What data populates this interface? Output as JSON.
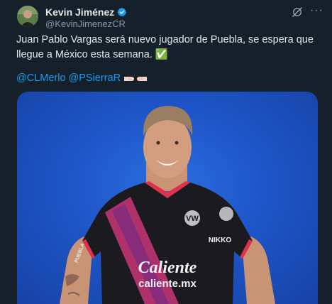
{
  "author": {
    "display_name": "Kevin Jiménez",
    "handle": "@KevinJimenezCR"
  },
  "icons": {
    "avatar": "avatar-photo",
    "verified": "verified-badge-icon",
    "grok": "grok-icon",
    "more": "more-options-icon",
    "check": "check-mark-emoji",
    "fists": "fist-bump-emoji"
  },
  "tweet": {
    "text": "Juan Pablo Vargas será nuevo jugador de Puebla, se espera que llegue a México esta semana. ✅",
    "mentions": [
      "@CLMerlo",
      "@PSierraR"
    ],
    "more_glyph": "···"
  },
  "media": {
    "jersey_sponsor_main": "Caliente",
    "jersey_sponsor_url": "caliente.mx",
    "jersey_brand": "NIKKO",
    "jersey_sleeve": "PUEBLA"
  },
  "colors": {
    "background": "#15202b",
    "accent": "#1d9bf0",
    "muted": "#8b98a5",
    "photo_bg": "#1e56c8"
  }
}
